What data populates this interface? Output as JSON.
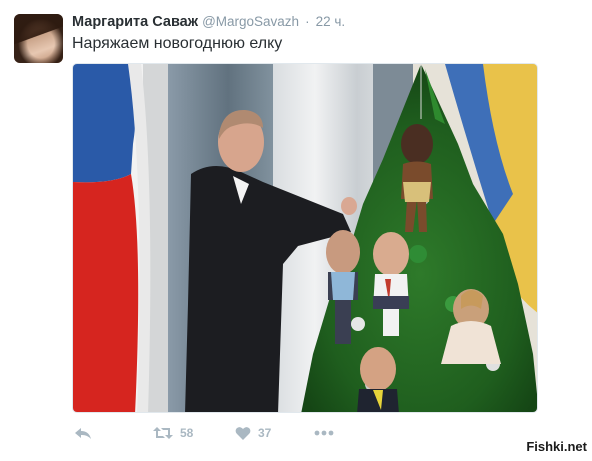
{
  "tweet": {
    "author_name": "Маргарита Саваж",
    "author_handle": "@MargoSavazh",
    "separator": "·",
    "time": "22 ч.",
    "text": "Наряжаем новогоднюю елку"
  },
  "media": {
    "description_icon": "photo-image"
  },
  "actions": {
    "reply_icon": "reply-icon",
    "retweet_icon": "retweet-icon",
    "retweet_count": "58",
    "like_icon": "heart-icon",
    "like_count": "37",
    "more_icon": "more-icon"
  },
  "watermark": {
    "text": "Fishki.net"
  },
  "colors": {
    "text": "#292f33",
    "muted": "#8899a6",
    "action": "#aab8c2",
    "border": "#e1e8ed"
  }
}
